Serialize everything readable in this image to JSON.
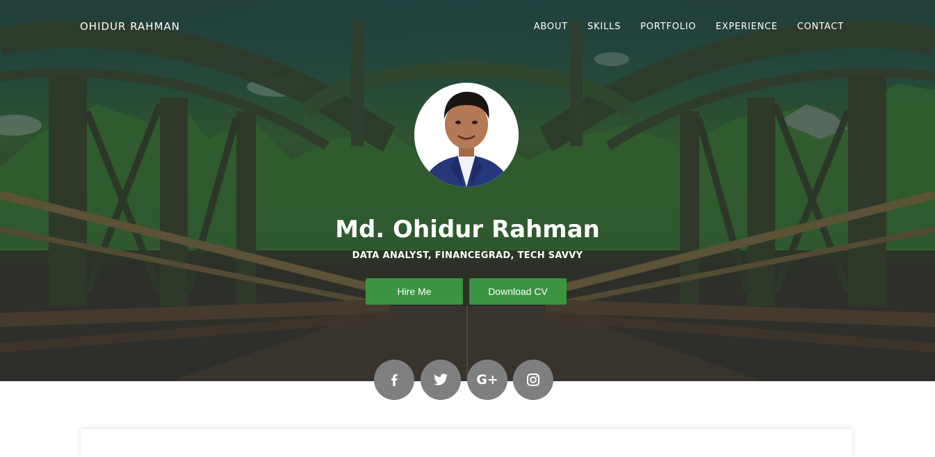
{
  "nav": {
    "brand": "OHIDUR RAHMAN",
    "items": [
      {
        "label": "ABOUT"
      },
      {
        "label": "SKILLS"
      },
      {
        "label": "PORTFOLIO"
      },
      {
        "label": "EXPERIENCE"
      },
      {
        "label": "CONTACT"
      }
    ]
  },
  "hero": {
    "name": "Md. Ohidur Rahman",
    "tagline": "DATA ANALYST, FINANCEGRAD, TECH SAVVY",
    "buttons": {
      "hire": "Hire Me",
      "download_cv": "Download CV"
    },
    "social": [
      {
        "icon": "facebook-icon"
      },
      {
        "icon": "twitter-icon"
      },
      {
        "icon": "google-plus-icon",
        "glyph": "G+"
      },
      {
        "icon": "instagram-icon"
      }
    ],
    "colors": {
      "button": "#3a9440",
      "social_circle": "#7f7f7f"
    }
  }
}
